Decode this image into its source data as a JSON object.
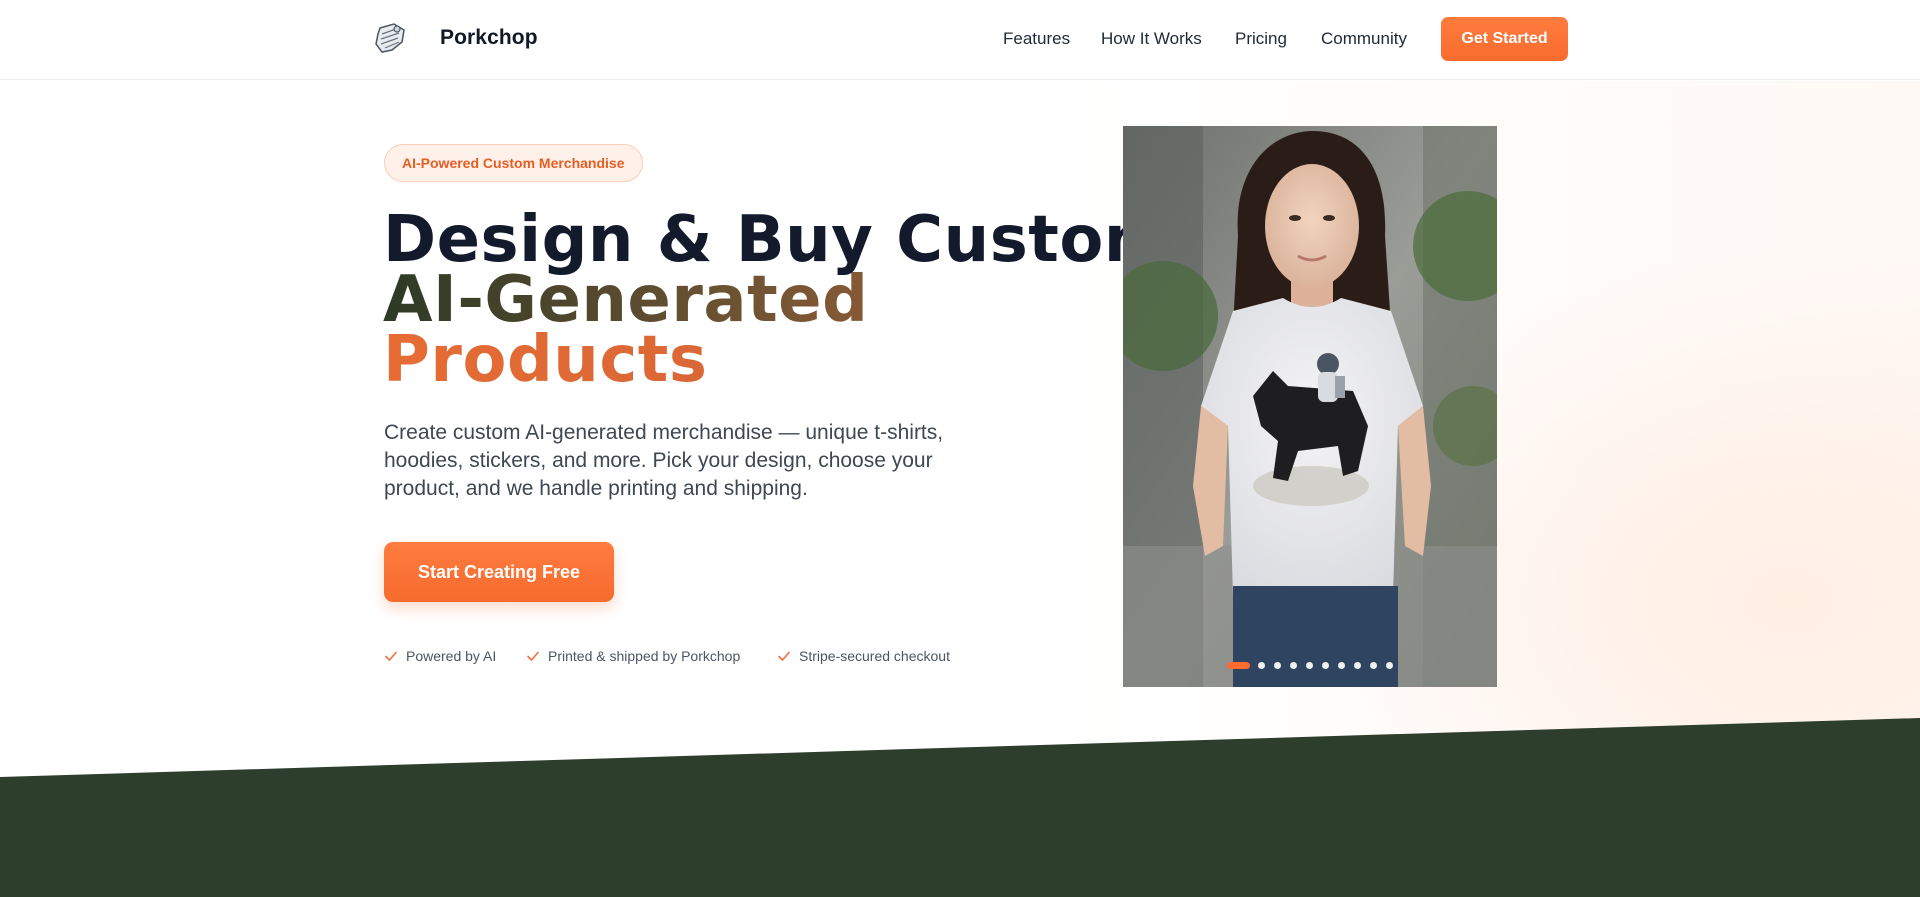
{
  "brand": {
    "name": "Porkchop",
    "logo_icon": "porkchop-logo-icon"
  },
  "nav": {
    "items": [
      {
        "label": "Features"
      },
      {
        "label": "How It Works"
      },
      {
        "label": "Pricing"
      },
      {
        "label": "Community"
      }
    ],
    "cta_label": "Get Started"
  },
  "hero": {
    "badge": "AI-Powered Custom Merchandise",
    "headline": {
      "line1": "Design & Buy Custom",
      "line2": "AI-Generated",
      "line3": "Products"
    },
    "description": "Create custom AI-generated merchandise — unique t-shirts, hoodies, stickers, and more. Pick your design, choose your product, and we handle printing and shipping.",
    "cta_label": "Start Creating Free",
    "checks": [
      {
        "label": "Powered by AI",
        "icon": "check-icon"
      },
      {
        "label": "Printed & shipped by Porkchop",
        "icon": "check-icon"
      },
      {
        "label": "Stripe-secured checkout",
        "icon": "check-icon"
      }
    ]
  },
  "carousel": {
    "total_slides": 11,
    "active_slide": 1
  },
  "colors": {
    "accent": "#ff6b2e",
    "band": "#2d3e2d",
    "headline_dark": "#131a2b"
  }
}
